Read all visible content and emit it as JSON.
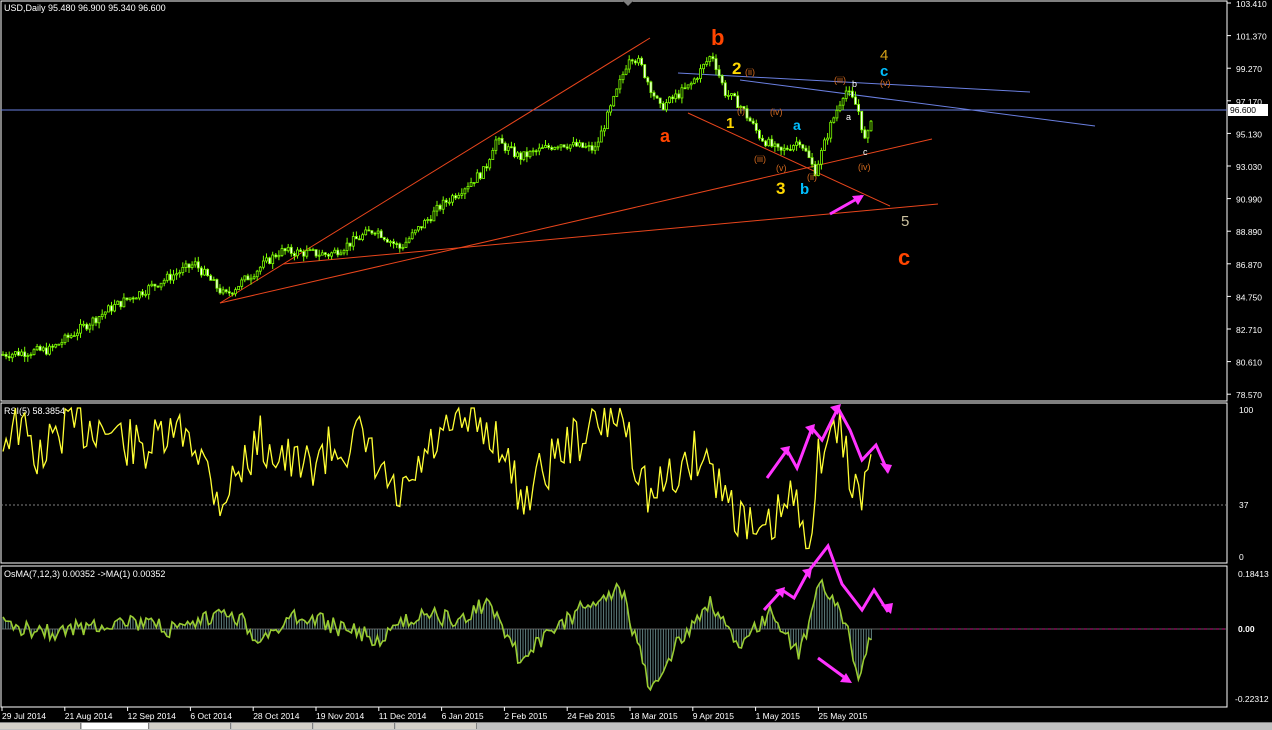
{
  "window": {
    "symbol_header": "USD,Daily  95.480 96.900 95.340 96.600",
    "current_price_label": "96.600"
  },
  "price_axis": [
    "103.410",
    "101.370",
    "99.270",
    "97.170",
    "95.130",
    "93.030",
    "90.990",
    "88.890",
    "86.870",
    "84.750",
    "82.710",
    "80.610",
    "78.570"
  ],
  "rsi_panel": {
    "header": "RSI(5) 58.3854",
    "axis": [
      "100",
      "37",
      "0"
    ],
    "level": 37
  },
  "osma_panel": {
    "header": "OsMA(7,12,3) 0.00352  ->MA(1) 0.00352",
    "axis": [
      "0.18413",
      "0.00",
      "-0.22312"
    ]
  },
  "date_axis": [
    "29 Jul 2014",
    "21 Aug 2014",
    "12 Sep 2014",
    "6 Oct 2014",
    "28 Oct 2014",
    "19 Nov 2014",
    "11 Dec 2014",
    "6 Jan 2015",
    "2 Feb 2015",
    "24 Feb 2015",
    "18 Mar 2015",
    "9 Apr 2015",
    "1 May 2015",
    "25 May 2015"
  ],
  "wave_labels": {
    "a": "a",
    "b": "b",
    "c_big": "c",
    "w1": "1",
    "w2": "2",
    "w3": "3",
    "w4": "4",
    "w5": "5",
    "blue_a": "a",
    "blue_b": "b",
    "blue_c": "c",
    "i": "(i)",
    "ii": "(ii)",
    "iii": "(iii)",
    "iv": "(iv)",
    "v": "(v)",
    "ii_2": "(ii)",
    "iii_2": "(iii)",
    "iv_2": "(iv)",
    "v_2": "(v)",
    "small_a": "a",
    "small_b": "b",
    "small_c": "c"
  },
  "colors": {
    "background": "#000000",
    "candle": "#7cfc00",
    "rsi_line": "#ffff33",
    "osma_line": "#9acd32",
    "trendline": "#e8451c",
    "blue_channel": "#6a7fe0",
    "arrows": "#ff33ff",
    "wave_orange": "#ff4500",
    "wave_yellow": "#ffd700",
    "wave_blue": "#00bfff",
    "wave_small": "#d2691e"
  },
  "chart_data": {
    "type": "candlestick",
    "title": "USD,Daily",
    "ohlc_last": {
      "open": 95.48,
      "high": 96.9,
      "low": 95.34,
      "close": 96.6
    },
    "ylim": [
      78.57,
      103.41
    ],
    "x_dates": [
      "29 Jul 2014",
      "21 Aug 2014",
      "12 Sep 2014",
      "6 Oct 2014",
      "28 Oct 2014",
      "19 Nov 2014",
      "11 Dec 2014",
      "6 Jan 2015",
      "2 Feb 2015",
      "24 Feb 2015",
      "18 Mar 2015",
      "9 Apr 2015",
      "1 May 2015",
      "25 May 2015"
    ],
    "close_series": [
      {
        "date": "29 Jul 2014",
        "close": 81.3
      },
      {
        "date": "21 Aug 2014",
        "close": 82.6
      },
      {
        "date": "12 Sep 2014",
        "close": 84.3
      },
      {
        "date": "6 Oct 2014",
        "close": 86.0
      },
      {
        "date": "28 Oct 2014",
        "close": 85.8
      },
      {
        "date": "19 Nov 2014",
        "close": 87.8
      },
      {
        "date": "11 Dec 2014",
        "close": 88.2
      },
      {
        "date": "6 Jan 2015",
        "close": 91.6
      },
      {
        "date": "2 Feb 2015",
        "close": 94.7
      },
      {
        "date": "24 Feb 2015",
        "close": 95.2
      },
      {
        "date": "18 Mar 2015",
        "close": 98.5
      },
      {
        "date": "9 Apr 2015",
        "close": 99.0
      },
      {
        "date": "1 May 2015",
        "close": 94.7
      },
      {
        "date": "25 May 2015",
        "close": 96.6
      }
    ],
    "rsi": {
      "period": 5,
      "last": 58.3854,
      "range": [
        0,
        100
      ]
    },
    "osma": {
      "params": "7,12,3",
      "last": 0.00352,
      "range": [
        -0.22312,
        0.18413
      ]
    }
  }
}
